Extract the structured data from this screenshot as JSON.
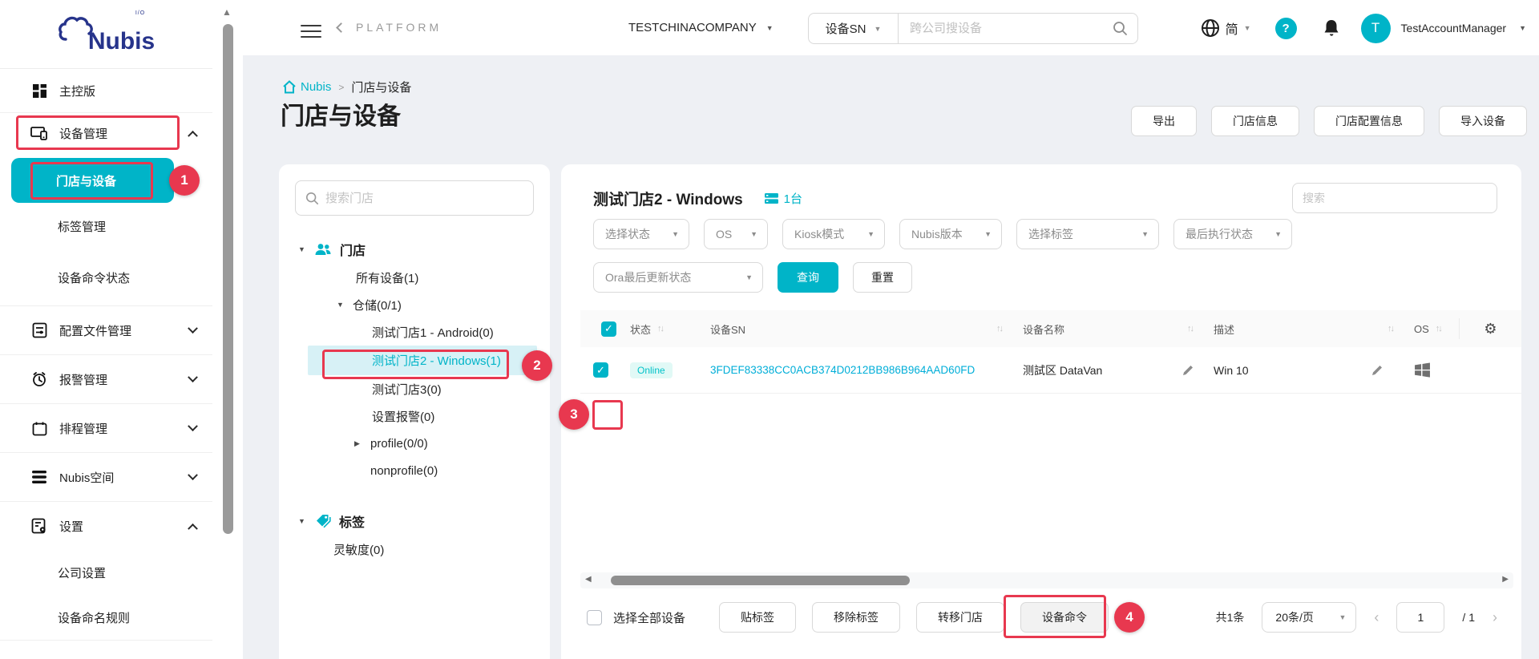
{
  "brand": {
    "logo_text": "Nubis",
    "logo_sup": "I/O"
  },
  "sidebar": {
    "dashboard": "主控版",
    "device_mgmt": "设备管理",
    "stores_devices": "门店与设备",
    "tag_mgmt": "标签管理",
    "cmd_status": "设备命令状态",
    "profile_mgmt": "配置文件管理",
    "alarm_mgmt": "报警管理",
    "schedule_mgmt": "排程管理",
    "nubis_space": "Nubis空间",
    "settings": "设置",
    "company_settings": "公司设置",
    "naming_rules": "设备命名规则"
  },
  "topbar": {
    "platform": "PLATFORM",
    "company": "TESTCHINACOMPANY",
    "search_type": "设备SN",
    "search_placeholder": "跨公司搜设备",
    "lang": "简",
    "help": "?",
    "avatar_initial": "T",
    "account": "TestAccountManager"
  },
  "breadcrumb": {
    "home": "Nubis",
    "sep": ">",
    "current": "门店与设备"
  },
  "page": {
    "title": "门店与设备",
    "actions": {
      "0": "导出",
      "1": "门店信息",
      "2": "门店配置信息",
      "3": "导入设备"
    }
  },
  "tree": {
    "search_placeholder": "搜索门店",
    "group_stores": "门店",
    "all_devices": "所有设备(1)",
    "warehouse": "仓储(0/1)",
    "store1": "测试门店1 - Android(0)",
    "store2": "测试门店2 - Windows(1)",
    "store3": "测试门店3(0)",
    "alarm_store": "设置报警(0)",
    "profile": "profile(0/0)",
    "nonprofile": "nonprofile(0)",
    "group_tags": "标签",
    "tag1": "灵敏度(0)"
  },
  "panel": {
    "title": "测试门店2 - Windows",
    "device_count": "1台",
    "search_placeholder": "搜索",
    "filters": {
      "0": "选择状态",
      "1": "OS",
      "2": "Kiosk模式",
      "3": "Nubis版本",
      "4": "选择标签",
      "5": "最后执行状态",
      "6": "Ora最后更新状态"
    },
    "query": "查询",
    "reset": "重置"
  },
  "table": {
    "headers": {
      "status": "状态",
      "sn": "设备SN",
      "name": "设备名称",
      "desc": "描述",
      "os": "OS"
    },
    "row": {
      "status": "Online",
      "sn": "3FDEF83338CC0ACB374D0212BB986B964AAD60FD",
      "name": "测試区 DataVan",
      "desc": "Win 10"
    }
  },
  "footer": {
    "select_all": "选择全部设备",
    "actions": {
      "0": "贴标签",
      "1": "移除标签",
      "2": "转移门店",
      "3": "设备命令"
    },
    "total": "共1条",
    "page_size": "20条/页",
    "page": "1",
    "page_total": "/ 1"
  },
  "annotations": {
    "step1": "1",
    "step2": "2",
    "step3": "3",
    "step4": "4"
  },
  "icons": {
    "sort": "↑↓",
    "gear": "⚙",
    "caret_down": "▼",
    "caret_right": "▶",
    "check": "✓",
    "prev": "‹",
    "next": "›",
    "scroll_left": "◀",
    "scroll_right": "▶",
    "scroll_up": "▲"
  },
  "colors": {
    "accent": "#00b4c8",
    "annotation": "#e8384f",
    "link": "#00aed8"
  }
}
